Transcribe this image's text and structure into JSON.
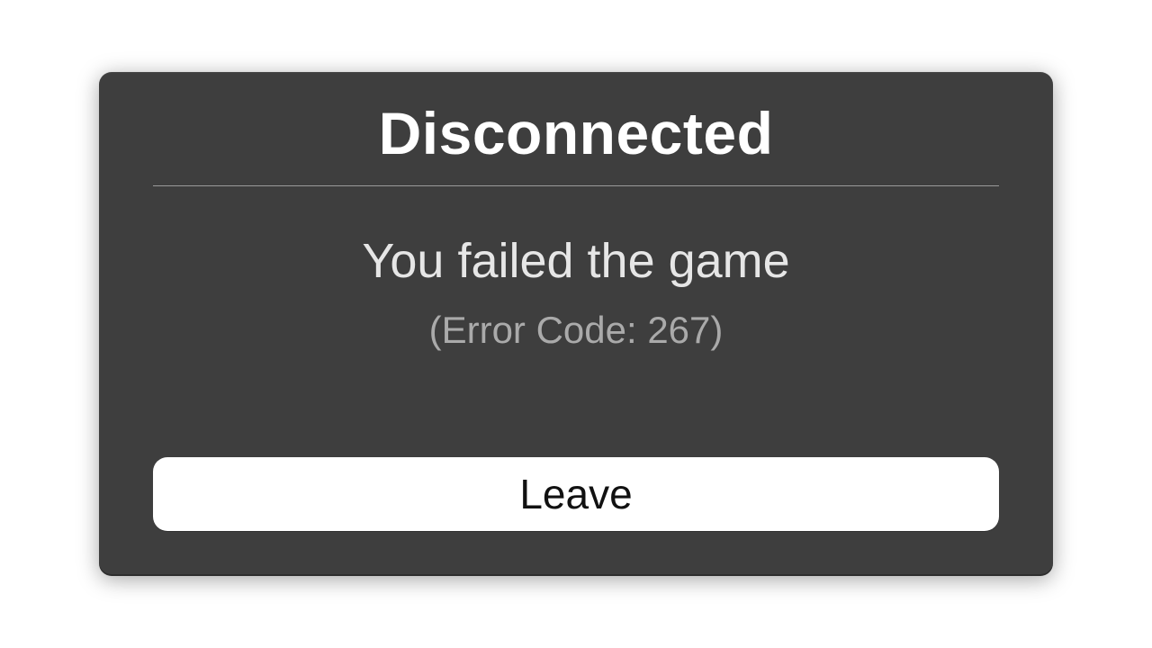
{
  "dialog": {
    "title": "Disconnected",
    "message": "You failed the game",
    "error_code_label": "(Error Code: 267)",
    "leave_button_label": "Leave"
  },
  "colors": {
    "dialog_bg": "#3e3e3e",
    "title_text": "#ffffff",
    "message_text": "#e6e6e6",
    "error_text": "#aaaaaa",
    "button_bg": "#ffffff",
    "button_text": "#111111",
    "divider": "#9a9a9a"
  }
}
